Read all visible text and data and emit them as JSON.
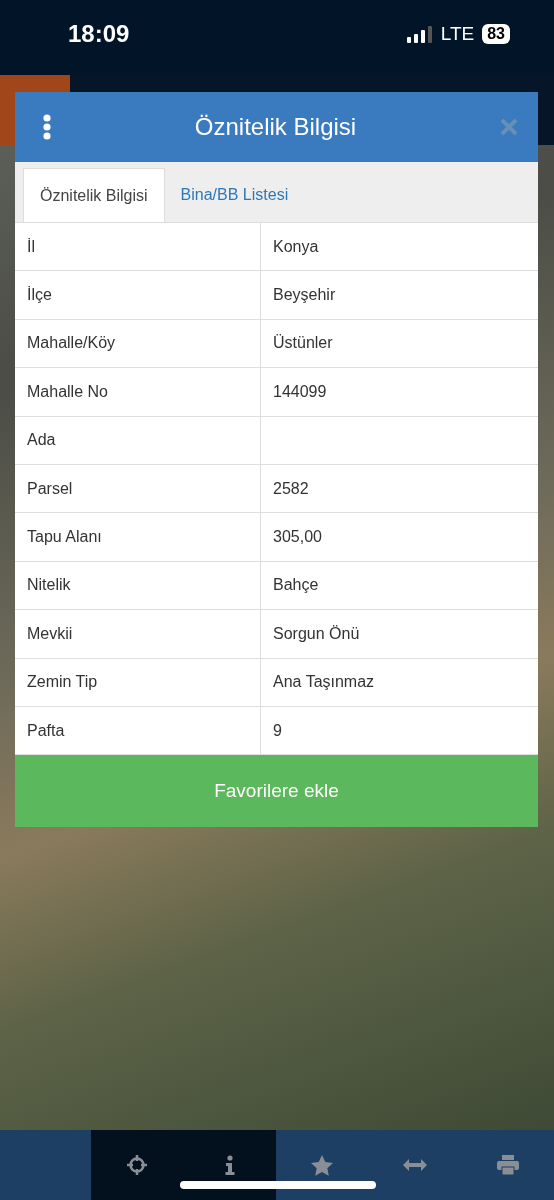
{
  "status_bar": {
    "time": "18:09",
    "network": "LTE",
    "battery": "83"
  },
  "dialog": {
    "title": "Öznitelik Bilgisi",
    "tabs": [
      {
        "label": "Öznitelik Bilgisi",
        "selected": true
      },
      {
        "label": "Bina/BB Listesi",
        "selected": false
      }
    ],
    "rows": [
      {
        "label": "İl",
        "value": "Konya"
      },
      {
        "label": "İlçe",
        "value": "Beyşehir"
      },
      {
        "label": "Mahalle/Köy",
        "value": "Üstünler"
      },
      {
        "label": "Mahalle No",
        "value": "144099"
      },
      {
        "label": "Ada"
      },
      {
        "label": "Parsel",
        "value": "2582"
      },
      {
        "label": "Tapu Alanı",
        "value": "305,00"
      },
      {
        "label": "Nitelik",
        "value": "Bahçe"
      },
      {
        "label": "Mevkii",
        "value": "Sorgun Önü"
      },
      {
        "label": "Zemin Tip",
        "value": "Ana Taşınmaz"
      },
      {
        "label": "Pafta",
        "value": "9"
      }
    ],
    "action": "Favorilere ekle"
  },
  "toolbar": [
    {
      "kind": "locate",
      "selected": true
    },
    {
      "kind": "info",
      "selected": true
    },
    {
      "kind": "favorite",
      "selected": false
    },
    {
      "kind": "measure",
      "selected": false
    },
    {
      "kind": "print",
      "selected": false
    }
  ]
}
